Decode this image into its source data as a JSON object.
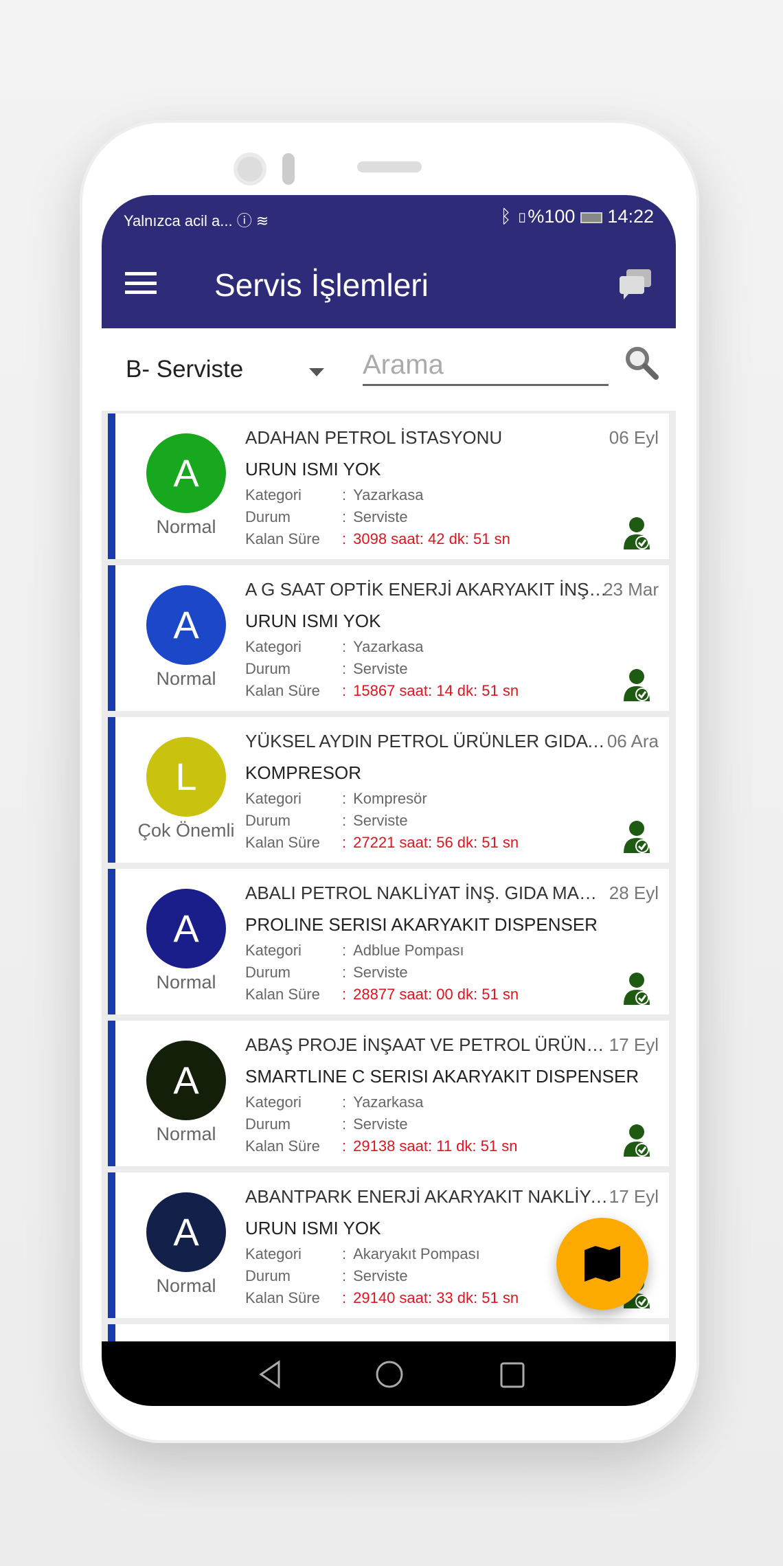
{
  "status_bar": {
    "carrier": "Yalnızca acil a...",
    "battery": "%100",
    "time": "14:22"
  },
  "header": {
    "title": "Servis İşlemleri"
  },
  "filter": {
    "selected": "B- Serviste",
    "search_placeholder": "Arama"
  },
  "labels": {
    "kategori": "Kategori",
    "durum": "Durum",
    "kalan": "Kalan Süre",
    "sep": ":"
  },
  "cards": [
    {
      "letter": "A",
      "color": "#17a81f",
      "priority": "Normal",
      "title": "ADAHAN PETROL İSTASYONU",
      "date": "06 Eyl",
      "product": "URUN ISMI YOK",
      "kategori": "Yazarkasa",
      "durum": "Serviste",
      "kalan": "3098 saat: 42 dk: 51 sn"
    },
    {
      "letter": "A",
      "color": "#1c47c8",
      "priority": "Normal",
      "title": "A G SAAT OPTİK ENERJİ AKARYAKIT İNŞAAT",
      "date": "23 Mar",
      "product": "URUN ISMI YOK",
      "kategori": "Yazarkasa",
      "durum": "Serviste",
      "kalan": "15867 saat: 14 dk: 51 sn"
    },
    {
      "letter": "L",
      "color": "#c9c20f",
      "priority": "Çok Önemli",
      "title": "YÜKSEL AYDIN PETROL ÜRÜNLER GIDA SAN.",
      "date": "06 Ara",
      "product": "KOMPRESOR",
      "kategori": "Kompresör",
      "durum": "Serviste",
      "kalan": "27221 saat: 56 dk: 51 sn"
    },
    {
      "letter": "A",
      "color": "#1a1e8a",
      "priority": "Normal",
      "title": "ABALI PETROL NAKLİYAT İNŞ. GIDA MADENCİLİK",
      "date": "28 Eyl",
      "product": "PROLINE SERISI  AKARYAKIT DISPENSER",
      "kategori": "Adblue Pompası",
      "durum": "Serviste",
      "kalan": "28877 saat: 00 dk: 51 sn"
    },
    {
      "letter": "A",
      "color": "#141f0a",
      "priority": "Normal",
      "title": "ABAŞ PROJE İNŞAAT VE PETROL ÜRÜNLERİ",
      "date": "17 Eyl",
      "product": "SMARTLINE C SERISI AKARYAKIT DISPENSER",
      "kategori": "Yazarkasa",
      "durum": "Serviste",
      "kalan": "29138 saat: 11 dk: 51 sn"
    },
    {
      "letter": "A",
      "color": "#13204a",
      "priority": "Normal",
      "title": "ABANTPARK ENERJİ AKARYAKIT NAKLİYAT",
      "date": "17 Eyl",
      "product": "URUN ISMI YOK",
      "kategori": "Akaryakıt Pompası",
      "durum": "Serviste",
      "kalan": "29140 saat: 33 dk: 51 sn"
    }
  ]
}
